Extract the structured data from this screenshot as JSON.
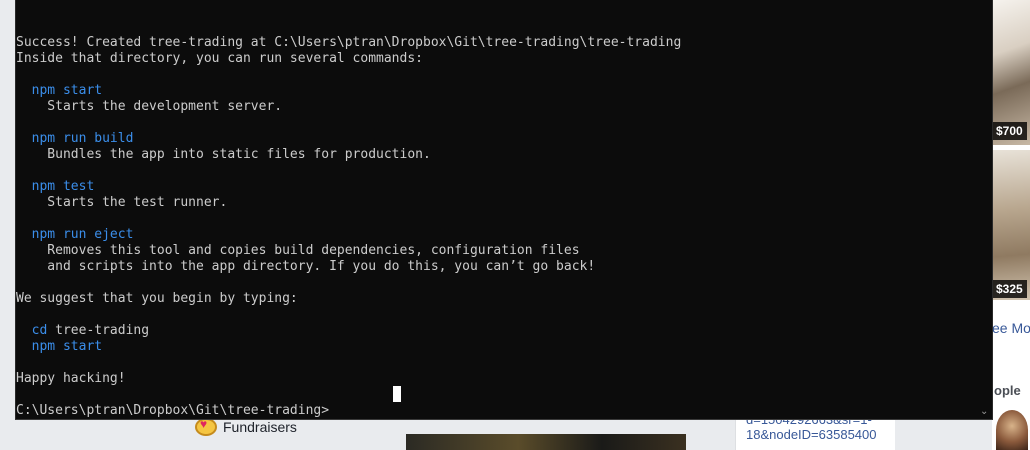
{
  "terminal": {
    "lines": [
      {
        "text": "Success! Created tree-trading at C:\\Users\\ptran\\Dropbox\\Git\\tree-trading\\tree-trading"
      },
      {
        "text": "Inside that directory, you can run several commands:"
      },
      {
        "text": ""
      },
      {
        "indent": "  ",
        "cmd": "npm start"
      },
      {
        "text": "    Starts the development server."
      },
      {
        "text": ""
      },
      {
        "indent": "  ",
        "cmd": "npm run build"
      },
      {
        "text": "    Bundles the app into static files for production."
      },
      {
        "text": ""
      },
      {
        "indent": "  ",
        "cmd": "npm test"
      },
      {
        "text": "    Starts the test runner."
      },
      {
        "text": ""
      },
      {
        "indent": "  ",
        "cmd": "npm run eject"
      },
      {
        "text": "    Removes this tool and copies build dependencies, configuration files"
      },
      {
        "text": "    and scripts into the app directory. If you do this, you can’t go back!"
      },
      {
        "text": ""
      },
      {
        "text": "We suggest that you begin by typing:"
      },
      {
        "text": ""
      },
      {
        "indent": "  ",
        "cmd": "cd",
        "rest": " tree-trading"
      },
      {
        "indent": "  ",
        "cmd": "npm start"
      },
      {
        "text": ""
      },
      {
        "text": "Happy hacking!"
      },
      {
        "text": ""
      },
      {
        "text": "C:\\Users\\ptran\\Dropbox\\Git\\tree-trading>"
      }
    ],
    "scroll_icon": "chevron-down-icon"
  },
  "background": {
    "fundraisers_label": "Fundraisers",
    "link_lines": [
      "d=1504292663&sr=1-",
      "18&nodeID=63585400"
    ],
    "ad_prices": [
      "$700",
      "$325"
    ],
    "see_more_text": "ee Mo",
    "people_label": "ople"
  },
  "colors": {
    "terminal_bg": "#0c0c0c",
    "terminal_text": "#cccccc",
    "command_blue": "#3b8eea",
    "page_bg": "#e9ebee",
    "link_blue": "#385898"
  }
}
